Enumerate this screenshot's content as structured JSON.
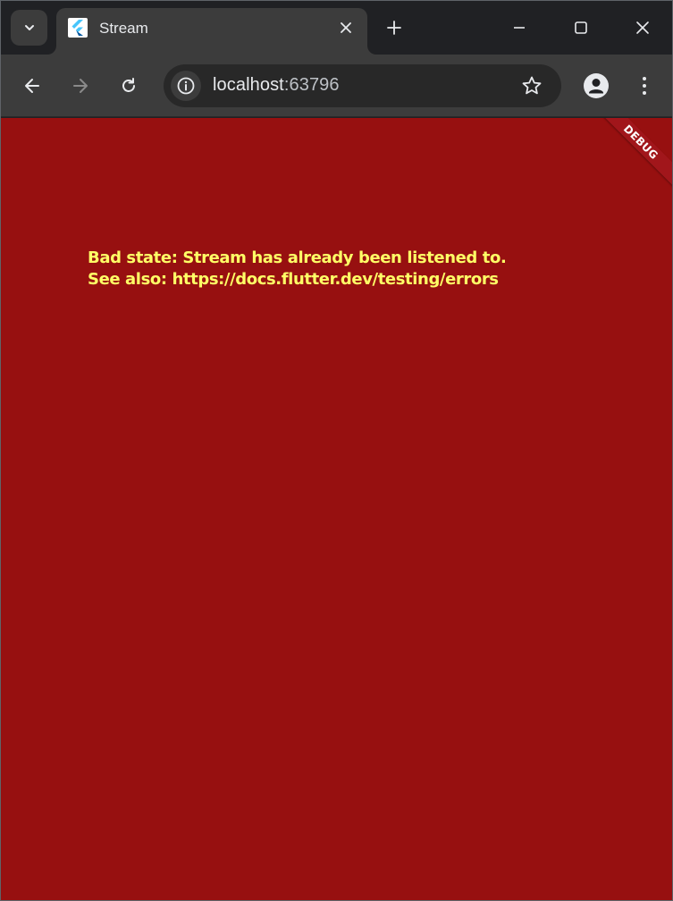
{
  "browser": {
    "tab": {
      "title": "Stream",
      "favicon": "flutter-icon"
    },
    "toolbar": {
      "url_host": "localhost",
      "url_port": ":63796"
    },
    "icons": {
      "tab_search": "chevron-down-icon",
      "tab_close": "close-icon",
      "new_tab": "plus-icon",
      "minimize": "minimize-icon",
      "maximize": "maximize-icon",
      "close_window": "close-icon",
      "back": "arrow-left-icon",
      "forward": "arrow-right-icon",
      "reload": "reload-icon",
      "site_info": "info-icon",
      "bookmark": "star-icon",
      "profile": "profile-icon",
      "menu": "kebab-menu-icon"
    }
  },
  "page": {
    "background": "#971010",
    "error": {
      "line1": "Bad state: Stream has already been listened to.",
      "line2": "See also: https://docs.flutter.dev/testing/errors",
      "color": "#ffff66"
    },
    "debug_banner": "DEBUG"
  }
}
